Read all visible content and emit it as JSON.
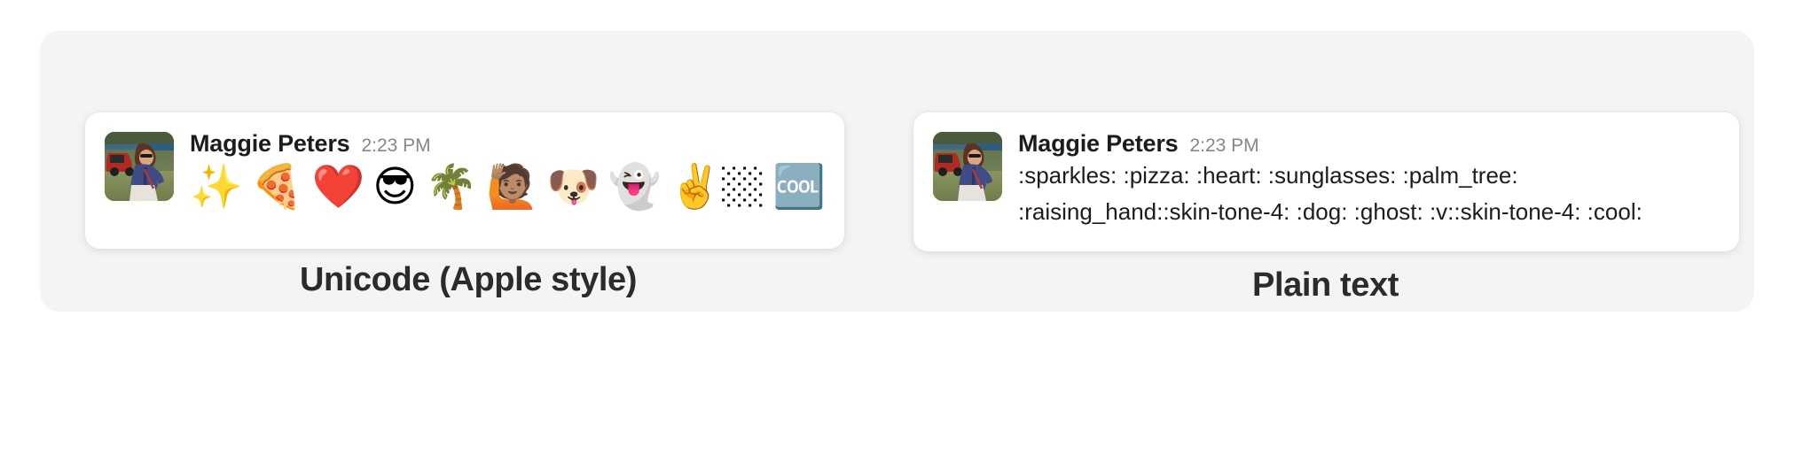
{
  "panel": {
    "background_color": "#f4f4f4",
    "card_background_color": "#ffffff",
    "text_color": "#1d1c1d",
    "timestamp_color": "#868686"
  },
  "columns": [
    {
      "id": "unicode",
      "caption": "Unicode (Apple style)",
      "message": {
        "author": "Maggie Peters",
        "timestamp": "2:23 PM",
        "avatar_alt": "photo of a woman wearing sunglasses standing outdoors in front of a red car",
        "rendering": "emoji",
        "emoji": [
          {
            "name": "sparkles",
            "glyph": "✨"
          },
          {
            "name": "pizza",
            "glyph": "🍕"
          },
          {
            "name": "heart",
            "glyph": "❤️"
          },
          {
            "name": "sunglasses",
            "glyph": "😎"
          },
          {
            "name": "palm_tree",
            "glyph": "🌴"
          },
          {
            "name": "raising_hand-skin-tone-4",
            "glyph": "🙋🏽"
          },
          {
            "name": "dog",
            "glyph": "🐶"
          },
          {
            "name": "ghost",
            "glyph": "👻"
          },
          {
            "name": "v-skin-tone-4",
            "glyph": "✌️🏼"
          },
          {
            "name": "cool",
            "glyph": "🆒"
          }
        ]
      }
    },
    {
      "id": "plaintext",
      "caption": "Plain text",
      "message": {
        "author": "Maggie Peters",
        "timestamp": "2:23 PM",
        "avatar_alt": "photo of a woman wearing sunglasses standing outdoors in front of a red car",
        "rendering": "text",
        "lines": [
          ":sparkles: :pizza: :heart: :sunglasses: :palm_tree:",
          ":raising_hand::skin-tone-4: :dog: :ghost: :v::skin-tone-4: :cool:"
        ]
      }
    }
  ]
}
